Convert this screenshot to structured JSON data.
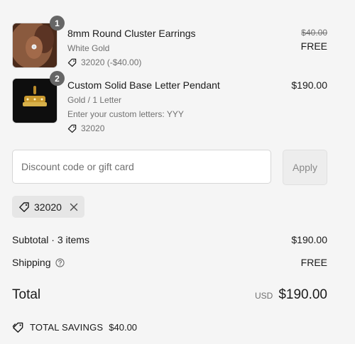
{
  "items": [
    {
      "qty": "1",
      "title": "8mm Round Cluster Earrings",
      "variant": "White Gold",
      "discount": "32020 (-$40.00)",
      "original_price": "$40.00",
      "price": "FREE",
      "image_icon": "earring-photo"
    },
    {
      "qty": "2",
      "title": "Custom Solid Base Letter Pendant",
      "variant": "Gold / 1 Letter",
      "custom_note": "Enter your custom letters: YYY",
      "discount": "32020",
      "price": "$190.00",
      "image_icon": "pendant-photo"
    }
  ],
  "discount_form": {
    "placeholder": "Discount code or gift card",
    "value": "",
    "apply_label": "Apply"
  },
  "applied_code": {
    "code": "32020",
    "icon": "tag-icon",
    "remove_icon": "close-icon"
  },
  "summary": {
    "subtotal_label": "Subtotal · 3 items",
    "subtotal_value": "$190.00",
    "shipping_label": "Shipping",
    "shipping_value": "FREE",
    "total_label": "Total",
    "currency": "USD",
    "total_value": "$190.00",
    "savings_label": "TOTAL SAVINGS",
    "savings_value": "$40.00"
  },
  "colors": {
    "background": "#f5f5f5",
    "text": "#1a1a1a",
    "muted": "#707070",
    "badge": "#666666"
  }
}
